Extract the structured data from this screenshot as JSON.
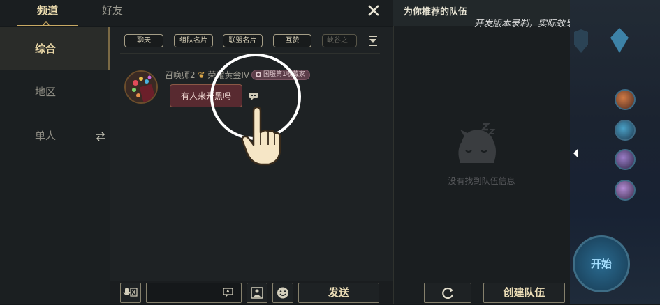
{
  "tabs": {
    "channel": "频道",
    "friends": "好友"
  },
  "sidebar": {
    "general": "综合",
    "region": "地区",
    "solo": "单人"
  },
  "filters": [
    "聊天",
    "组队名片",
    "联盟名片",
    "互赞",
    "峡谷之"
  ],
  "message": {
    "sender": "召唤师2",
    "rank": "荣耀黄金IV",
    "badge": "国服第1收藏家",
    "text": "有人来开黑吗"
  },
  "input": {
    "placeholder": "",
    "send_label": "发送"
  },
  "team_panel": {
    "title": "为你推荐的队伍",
    "empty_text": "没有找到队伍信息",
    "create_label": "创建队伍"
  },
  "watermark": "开发版本录制，实际效果以上线版本为准",
  "background": {
    "play_label": "开始"
  },
  "icons": {
    "close": "close-icon",
    "swap": "swap-icon",
    "expand": "chevron-down-icon",
    "report": "report-icon",
    "voice": "voice-icon",
    "image": "image-icon",
    "emoji": "emoji-icon",
    "refresh": "refresh-icon",
    "empty": "sleeping-poro-icon"
  },
  "colors": {
    "accent_gold": "#c9aa64",
    "bubble": "#582a30",
    "badge": "#5c3d49"
  }
}
